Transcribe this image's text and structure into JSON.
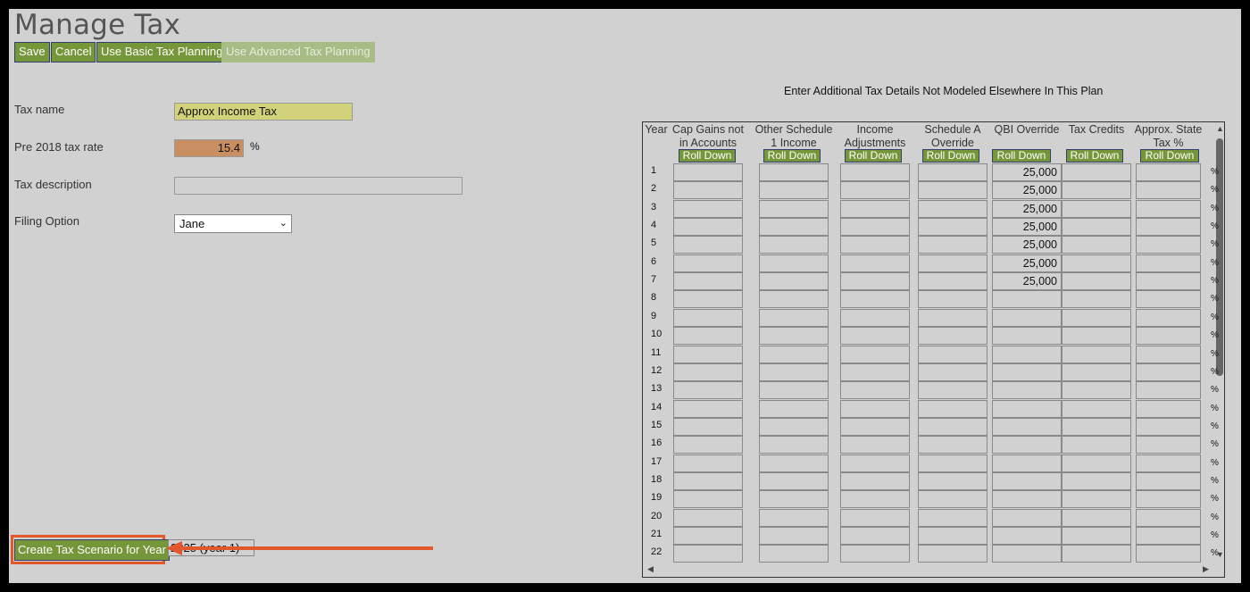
{
  "page": {
    "title": "Manage Tax"
  },
  "toolbar": {
    "save": "Save",
    "cancel": "Cancel",
    "basic": "Use Basic Tax Planning",
    "advanced": "Use Advanced Tax Planning"
  },
  "form": {
    "tax_name_label": "Tax name",
    "tax_name_value": "Approx Income Tax",
    "pre2018_label": "Pre 2018 tax rate",
    "pre2018_value": "15.4",
    "pre2018_unit": "%",
    "desc_label": "Tax description",
    "desc_value": "",
    "filing_label": "Filing Option",
    "filing_value": "Jane"
  },
  "grid": {
    "heading": "Enter Additional Tax Details Not Modeled Elsewhere In This Plan",
    "year_header": "Year",
    "roll_down": "Roll Down",
    "pct": "%",
    "columns": [
      "Cap Gains not in Accounts",
      "Other Schedule 1 Income",
      "Income Adjustments",
      "Schedule A Override",
      "QBI Override",
      "Tax Credits",
      "Approx. State Tax %"
    ],
    "rows": [
      "1",
      "2",
      "3",
      "4",
      "5",
      "6",
      "7",
      "8",
      "9",
      "10",
      "11",
      "12",
      "13",
      "14",
      "15",
      "16",
      "17",
      "18",
      "19",
      "20",
      "21",
      "22"
    ],
    "qbi_values": [
      "25,000",
      "25,000",
      "25,000",
      "25,000",
      "25,000",
      "25,000",
      "25,000",
      "",
      "",
      "",
      "",
      "",
      "",
      "",
      "",
      "",
      "",
      "",
      "",
      "",
      "",
      ""
    ]
  },
  "footer": {
    "create_btn": "Create Tax Scenario for Year",
    "year_select": "2025 (year 1)"
  },
  "colors": {
    "button_green": "#76963a",
    "highlight": "#e2582c",
    "tax_name_bg": "#d2d27a",
    "rate_bg": "#c98f63"
  }
}
